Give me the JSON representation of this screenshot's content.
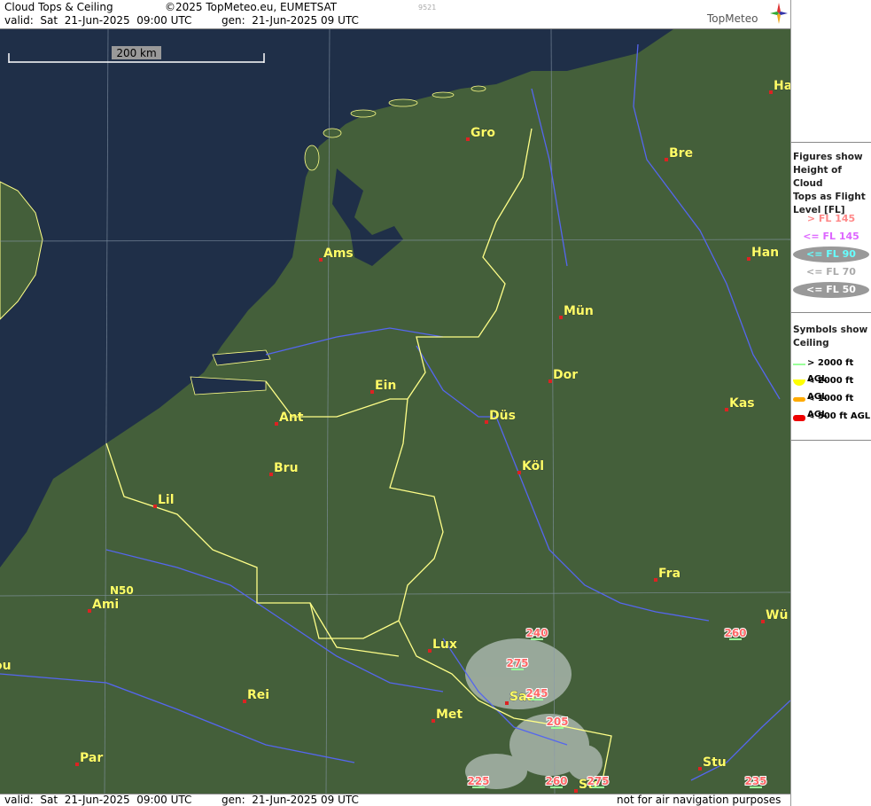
{
  "header": {
    "title": "Cloud Tops & Ceiling",
    "copyright": "©2025 TopMeteo.eu, EUMETSAT",
    "valid": "valid:  Sat  21-Jun-2025  09:00 UTC",
    "gen": "gen:  21-Jun-2025 09 UTC",
    "image_id": "9521",
    "logo": "TopMeteo"
  },
  "footer": {
    "valid": "valid:  Sat  21-Jun-2025  09:00 UTC",
    "gen": "gen:  21-Jun-2025 09 UTC",
    "disclaimer": "not for air navigation purposes"
  },
  "map": {
    "scale_label": "200 km",
    "grid_label": "N50",
    "colors": {
      "sea": "#1f2f48",
      "land": "#445f3a",
      "border": "#ffff88",
      "river": "#5566ee",
      "grid": "#8899aa"
    },
    "cities": [
      {
        "name": "Ha"
      },
      {
        "name": "Gro"
      },
      {
        "name": "Bre"
      },
      {
        "name": "Ams"
      },
      {
        "name": "Han"
      },
      {
        "name": "Mün"
      },
      {
        "name": "Dor"
      },
      {
        "name": "Ein"
      },
      {
        "name": "Kas"
      },
      {
        "name": "Ant"
      },
      {
        "name": "Düs"
      },
      {
        "name": "Köl"
      },
      {
        "name": "Bru"
      },
      {
        "name": "Lil"
      },
      {
        "name": "Fra"
      },
      {
        "name": "Ami"
      },
      {
        "name": "Wü"
      },
      {
        "name": "Lux"
      },
      {
        "name": "ou"
      },
      {
        "name": "Rei"
      },
      {
        "name": "Saa"
      },
      {
        "name": "Met"
      },
      {
        "name": "Par"
      },
      {
        "name": "Stu"
      },
      {
        "name": "Str"
      }
    ],
    "cloud_tops": [
      "240",
      "260",
      "275",
      "245",
      "205",
      "225",
      "260",
      "275",
      "235"
    ]
  },
  "legend": {
    "tops_heading": [
      "Figures show",
      "Height of Cloud",
      "Tops as Flight",
      "Level  [FL]"
    ],
    "tops_items": [
      {
        "label": "> FL 145",
        "color": "#ff8888"
      },
      {
        "label": "<= FL 145",
        "color": "#dd66ff"
      },
      {
        "label": "<= FL 90",
        "color": "#66ffff"
      },
      {
        "label": "<= FL 70",
        "color": "#aaaaaa"
      },
      {
        "label": "<= FL 50",
        "color": "#ffffff"
      }
    ],
    "ceil_heading": [
      "Symbols show",
      "Ceiling"
    ],
    "ceil_items": [
      {
        "label": "> 2000 ft AGL",
        "color": "#99ff99"
      },
      {
        "label": "< 2000 ft AGL",
        "color": "#ffff00"
      },
      {
        "label": "< 1000 ft AGL",
        "color": "#ffaa00"
      },
      {
        "label": "< 500 ft AGL",
        "color": "#ee0000"
      }
    ]
  }
}
